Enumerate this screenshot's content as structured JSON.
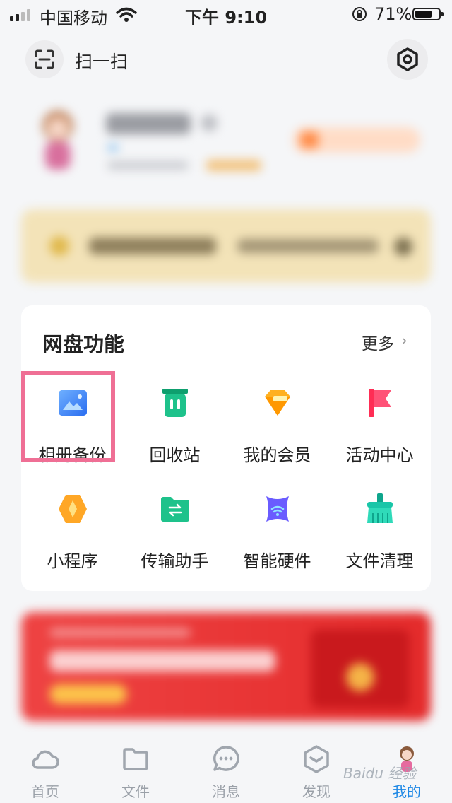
{
  "status_bar": {
    "carrier": "中国移动",
    "time": "下午 9:10",
    "battery_percent": "71%",
    "battery_level": 0.71,
    "signal_bars": 4,
    "signal_bars_filled": 2
  },
  "header": {
    "scan_label": "扫一扫"
  },
  "functions": {
    "title": "网盘功能",
    "more_label": "更多",
    "items": [
      {
        "label": "相册备份",
        "icon": "photo-album-icon",
        "color": "#3a86ff"
      },
      {
        "label": "回收站",
        "icon": "recycle-bin-icon",
        "color": "#16c08a"
      },
      {
        "label": "我的会员",
        "icon": "diamond-icon",
        "color": "#ffb020"
      },
      {
        "label": "活动中心",
        "icon": "flag-icon",
        "color": "#ff3a6e"
      },
      {
        "label": "小程序",
        "icon": "mini-program-icon",
        "color": "#ffa726"
      },
      {
        "label": "传输助手",
        "icon": "transfer-folder-icon",
        "color": "#1ec28b"
      },
      {
        "label": "智能硬件",
        "icon": "smart-hardware-icon",
        "color": "#6a5cff"
      },
      {
        "label": "文件清理",
        "icon": "broom-icon",
        "color": "#19c6a8"
      }
    ]
  },
  "tabbar": {
    "items": [
      {
        "label": "首页",
        "icon": "cloud-icon"
      },
      {
        "label": "文件",
        "icon": "folder-icon"
      },
      {
        "label": "消息",
        "icon": "chat-bubble-icon"
      },
      {
        "label": "发现",
        "icon": "discover-box-icon"
      },
      {
        "label": "我的",
        "icon": "avatar-icon"
      }
    ],
    "active_index": 4
  },
  "watermark": "Baidu 经验"
}
